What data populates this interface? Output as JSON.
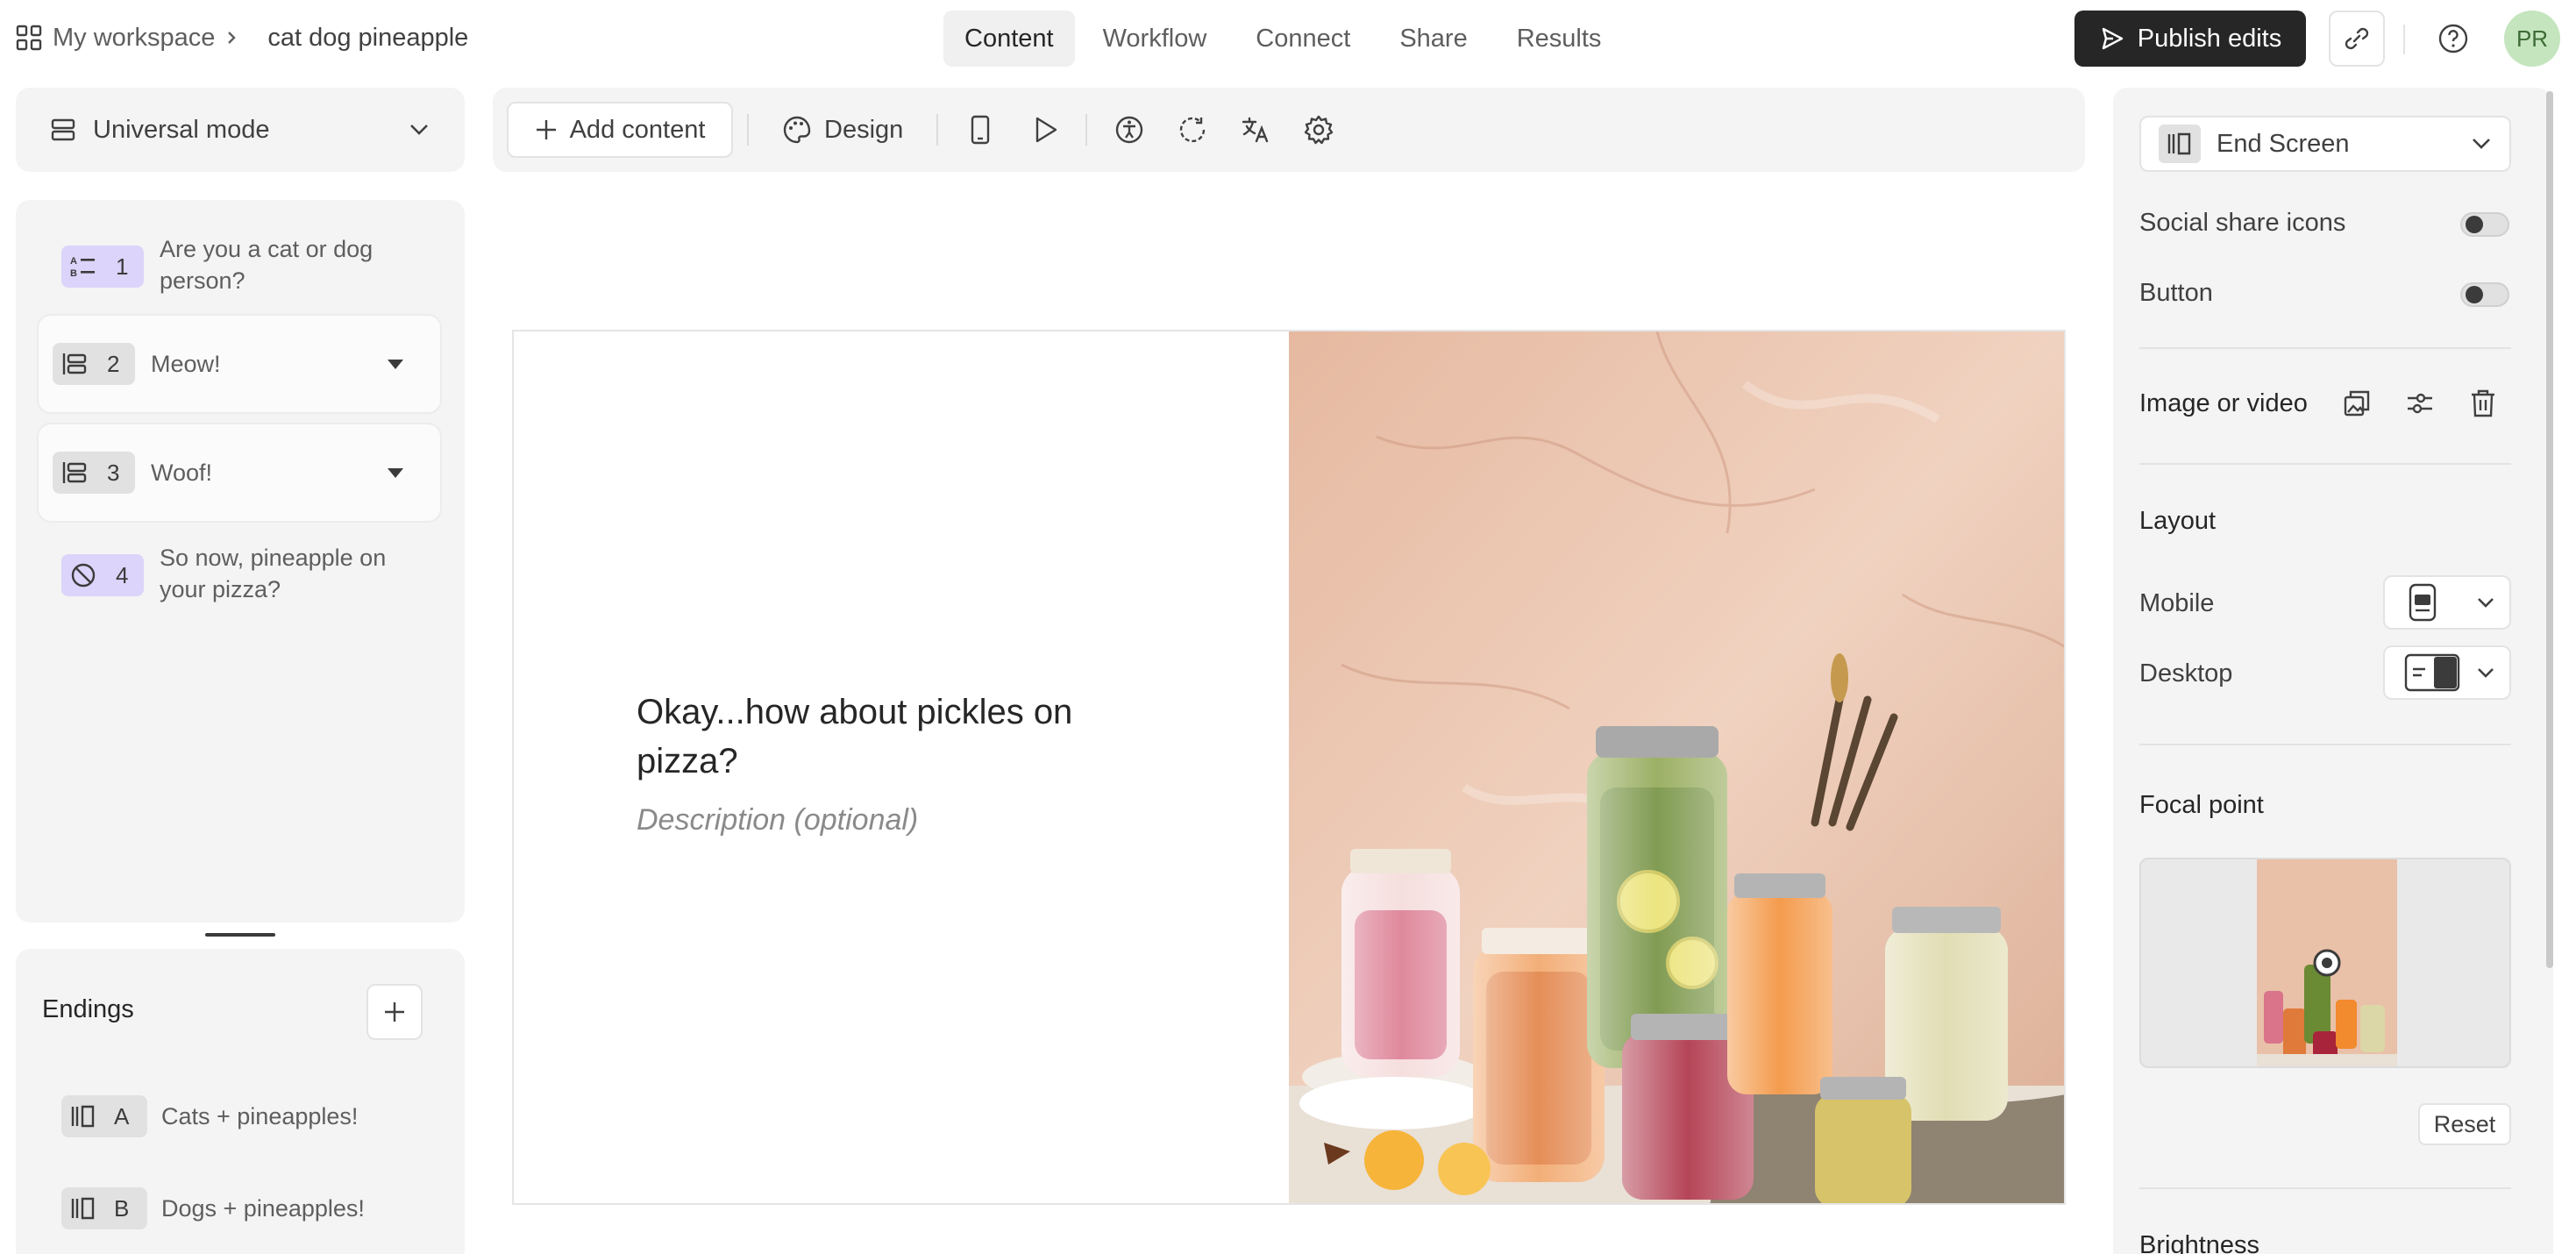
{
  "breadcrumb": {
    "workspace": "My workspace",
    "form_name": "cat dog pineapple"
  },
  "nav": {
    "tabs": [
      {
        "label": "Content",
        "active": true
      },
      {
        "label": "Workflow",
        "active": false
      },
      {
        "label": "Connect",
        "active": false
      },
      {
        "label": "Share",
        "active": false
      },
      {
        "label": "Results",
        "active": false
      }
    ]
  },
  "header": {
    "publish_label": "Publish edits",
    "avatar_initials": "PR"
  },
  "mode": {
    "label": "Universal mode"
  },
  "questions": [
    {
      "num": "1",
      "text": "Are you a cat or dog person?",
      "icon": "multiple-choice-icon"
    },
    {
      "num": "2",
      "text": "Meow!",
      "icon": "statement-icon"
    },
    {
      "num": "3",
      "text": "Woof!",
      "icon": "statement-icon"
    },
    {
      "num": "4",
      "text": "So now, pineapple on your pizza?",
      "icon": "yes-no-icon"
    }
  ],
  "endings": {
    "title": "Endings",
    "items": [
      {
        "letter": "A",
        "text": "Cats + pineapples!"
      },
      {
        "letter": "B",
        "text": "Dogs + pineapples!"
      }
    ]
  },
  "toolbar": {
    "add_content_label": "Add content",
    "design_label": "Design"
  },
  "canvas": {
    "title": "Okay...how about pickles on pizza?",
    "description_placeholder": "Description (optional)"
  },
  "settings": {
    "screen_type": "End Screen",
    "social_share_label": "Social share icons",
    "social_share_on": false,
    "button_label": "Button",
    "button_on": false,
    "image_label": "Image or video",
    "layout_heading": "Layout",
    "mobile_label": "Mobile",
    "desktop_label": "Desktop",
    "focal_heading": "Focal point",
    "reset_label": "Reset",
    "brightness_heading": "Brightness"
  },
  "colors": {
    "accent_dark": "#262627",
    "question_badge": "#dcd4fa",
    "statement_badge": "#e1e1e1",
    "avatar_bg": "#c4e5be"
  }
}
